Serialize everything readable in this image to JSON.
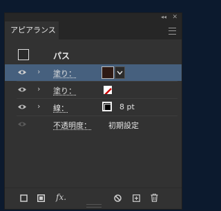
{
  "panel": {
    "tab_label": "アピアランス",
    "collapse_glyph": "◂◂",
    "close_glyph": "✕"
  },
  "header": {
    "label": "パス"
  },
  "rows": [
    {
      "label": "塗り：",
      "selected": true,
      "swatch": "dark-brown-fill"
    },
    {
      "label": "塗り：",
      "selected": false,
      "swatch": "none-swatch"
    },
    {
      "label": "線：",
      "selected": false,
      "swatch": "stroke-swatch",
      "value": "8 pt"
    },
    {
      "label": "不透明度：",
      "selected": false,
      "value": "初期設定"
    }
  ],
  "footer": {
    "fx_label": "fx."
  },
  "colors": {
    "selected_row": "#46607e",
    "panel_bg": "#323232",
    "fill_swatch": "#2e1a14",
    "none_slash": "#cc0000"
  }
}
